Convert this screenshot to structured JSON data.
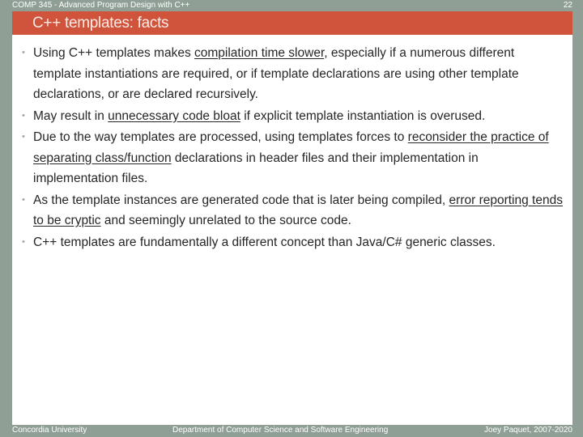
{
  "header": {
    "course": "COMP 345 - Advanced Program Design with C++",
    "page_number": "22"
  },
  "title": "C++ templates: facts",
  "colors": {
    "frame": "#909f96",
    "title_bar": "#cf543b",
    "title_text": "#fbe9e4",
    "body_text": "#262626",
    "bullet": "#a5a5a5",
    "content_bg": "#ffffff"
  },
  "bullet_icon": "small-gray-dot",
  "bullets": [
    {
      "segments": [
        {
          "text": "Using C++ templates makes ",
          "underline": false
        },
        {
          "text": "compilation time slower",
          "underline": true
        },
        {
          "text": ", especially if a numerous different template instantiations are required, or if template declarations are using other template declarations, or are declared recursively.",
          "underline": false
        }
      ]
    },
    {
      "segments": [
        {
          "text": "May result in ",
          "underline": false
        },
        {
          "text": "unnecessary code bloat",
          "underline": true
        },
        {
          "text": " if explicit template instantiation is overused.",
          "underline": false
        }
      ]
    },
    {
      "segments": [
        {
          "text": "Due to the way templates are processed, using templates forces to ",
          "underline": false
        },
        {
          "text": "reconsider the practice of separating class/function",
          "underline": true
        },
        {
          "text": " declarations in header files and their implementation in implementation files.",
          "underline": false
        }
      ]
    },
    {
      "segments": [
        {
          "text": "As the template instances are generated code that is later being compiled, ",
          "underline": false
        },
        {
          "text": "error reporting tends to be cryptic",
          "underline": true
        },
        {
          "text": " and seemingly unrelated to the source code.",
          "underline": false
        }
      ]
    },
    {
      "segments": [
        {
          "text": "C++ templates are fundamentally a different concept than Java/C# generic classes.",
          "underline": false
        }
      ]
    }
  ],
  "footer": {
    "left": "Concordia University",
    "center": "Department of Computer Science and Software Engineering",
    "right": "Joey Paquet, 2007-2020"
  }
}
